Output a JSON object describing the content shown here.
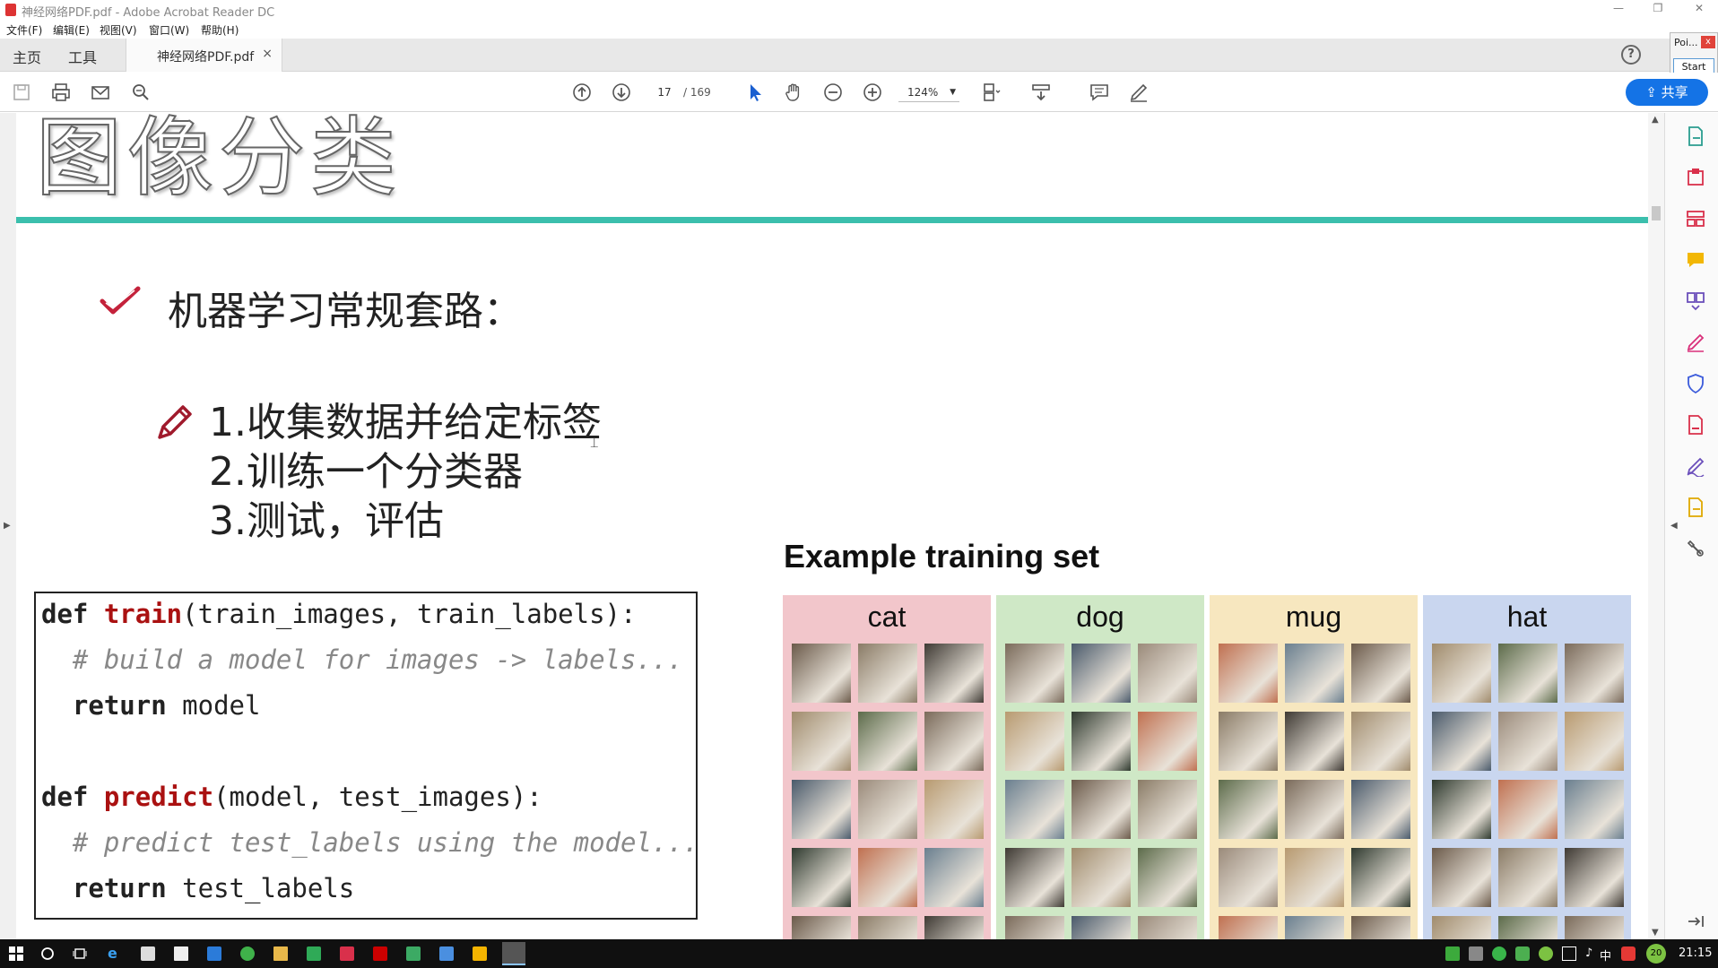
{
  "window": {
    "title": "神经网络PDF.pdf - Adobe Acrobat Reader DC",
    "minimize": "—",
    "restore": "❐",
    "close": "✕"
  },
  "menu": [
    "文件(F)",
    "编辑(E)",
    "视图(V)",
    "窗口(W)",
    "帮助(H)"
  ],
  "tabs": {
    "home": "主页",
    "tools": "工具",
    "document": "神经网络PDF.pdf",
    "close": "×"
  },
  "help_label": "?",
  "popup": {
    "title": "Poi...",
    "close": "x",
    "start": "Start"
  },
  "toolbar": {
    "page_current": "17",
    "page_total": "/ 169",
    "zoom": "124%",
    "zoom_caret": "▼",
    "share": "共享"
  },
  "slide": {
    "title": "图像分类",
    "heading": "机器学习常规套路：",
    "steps": [
      "1.收集数据并给定标签",
      "2.训练一个分类器",
      "3.测试，评估"
    ],
    "cursor": "⌶",
    "code": [
      [
        {
          "t": "def ",
          "c": "kw"
        },
        {
          "t": "train",
          "c": "fn"
        },
        {
          "t": "(train_images, train_labels):",
          "c": ""
        }
      ],
      [
        {
          "t": "  # build a model for images -> labels...",
          "c": "cm"
        }
      ],
      [
        {
          "t": "  ",
          "c": ""
        },
        {
          "t": "return",
          "c": "kw"
        },
        {
          "t": " model",
          "c": ""
        }
      ],
      [],
      [
        {
          "t": "def ",
          "c": "kw"
        },
        {
          "t": "predict",
          "c": "fn"
        },
        {
          "t": "(model, test_images):",
          "c": ""
        }
      ],
      [
        {
          "t": "  # predict test_labels using the model...",
          "c": "cm"
        }
      ],
      [
        {
          "t": "  ",
          "c": ""
        },
        {
          "t": "return",
          "c": "kw"
        },
        {
          "t": " test_labels",
          "c": ""
        }
      ]
    ],
    "example_title": "Example training set",
    "categories": [
      {
        "label": "cat",
        "bg": "#f2c6cb"
      },
      {
        "label": "dog",
        "bg": "#cfe8c6"
      },
      {
        "label": "mug",
        "bg": "#f7e7bf"
      },
      {
        "label": "hat",
        "bg": "#c9d6ef"
      }
    ]
  },
  "taskbar": {
    "ime": "中",
    "badge": "20",
    "time": "21:15"
  },
  "colors": {
    "accent_rule": "#3bbfad",
    "share_blue": "#1473e6",
    "check_red": "#c4223b",
    "fn_red": "#a11"
  }
}
